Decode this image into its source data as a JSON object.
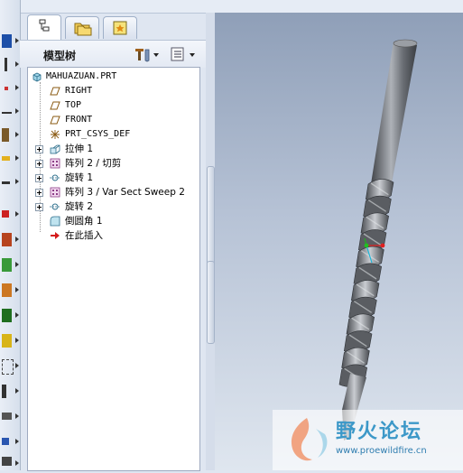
{
  "navigator": {
    "panel_title": "模型树",
    "tabs": [
      {
        "icon": "model-tree-tab-icon",
        "active": true
      },
      {
        "icon": "folder-browser-tab-icon",
        "active": false
      },
      {
        "icon": "favorites-tab-icon",
        "active": false
      }
    ]
  },
  "tree": {
    "root": "MAHUAZUAN.PRT",
    "items": [
      {
        "label": "RIGHT",
        "icon": "datum-plane-icon",
        "expandable": false
      },
      {
        "label": "TOP",
        "icon": "datum-plane-icon",
        "expandable": false
      },
      {
        "label": "FRONT",
        "icon": "datum-plane-icon",
        "expandable": false
      },
      {
        "label": "PRT_CSYS_DEF",
        "icon": "coordinate-system-icon",
        "expandable": false
      },
      {
        "label": "拉伸 1",
        "icon": "extrude-icon",
        "expandable": true
      },
      {
        "label": "阵列 2 / 切剪",
        "icon": "pattern-icon",
        "expandable": true
      },
      {
        "label": "旋转 1",
        "icon": "revolve-icon",
        "expandable": true
      },
      {
        "label": "阵列 3 / Var Sect Sweep 2",
        "icon": "pattern-icon",
        "expandable": true
      },
      {
        "label": "旋转 2",
        "icon": "revolve-icon",
        "expandable": true
      },
      {
        "label": "倒圆角 1",
        "icon": "round-icon",
        "expandable": false
      },
      {
        "label": "在此插入",
        "icon": "insert-here-arrow-icon",
        "expandable": false
      }
    ]
  },
  "watermark": {
    "title": "野火论坛",
    "url": "www.proewildfire.cn"
  },
  "colors": {
    "graphics_top": "#8f9fb8",
    "graphics_bottom": "#dfe6ef",
    "model_dark": "#4a4d52",
    "model_light": "#b8bcc2"
  }
}
